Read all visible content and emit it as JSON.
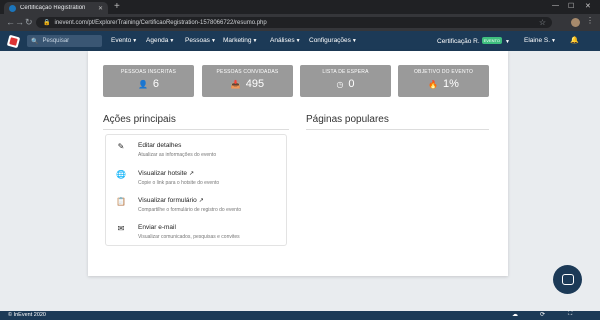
{
  "browser": {
    "tab_title": "Certificação Registration",
    "new_tab": "+",
    "url": "inevent.com/pt/ExplorerTraining/CertificaoRegistration-1578066722/resumo.php"
  },
  "appnav": {
    "search_placeholder": "Pesquisar",
    "menus": [
      "Evento",
      "Agenda",
      "Pessoas",
      "Marketing",
      "Análises",
      "Configurações"
    ],
    "event_name": "Certificação R.",
    "event_badge": "EVENTO",
    "user": "Elaine S."
  },
  "stats": [
    {
      "label": "PESSOAS INSCRITAS",
      "value": "6",
      "icon": "person-icon"
    },
    {
      "label": "PESSOAS CONVIDADAS",
      "value": "495",
      "icon": "inbox-icon"
    },
    {
      "label": "LISTA DE ESPERA",
      "value": "0",
      "icon": "clock-icon"
    },
    {
      "label": "OBJETIVO DO EVENTO",
      "value": "1%",
      "icon": "flame-icon"
    }
  ],
  "sections": {
    "actions_title": "Ações principais",
    "popular_title": "Páginas populares"
  },
  "actions": [
    {
      "title": "Editar detalhes",
      "desc": "Atualizar as informações do evento",
      "icon": "pencil-icon"
    },
    {
      "title": "Visualizar hotsite",
      "desc": "Copie o link para o hotsite do evento",
      "icon": "globe-icon"
    },
    {
      "title": "Visualizar formulário",
      "desc": "Compartilhe o formulário de registro do evento",
      "icon": "clipboard-icon"
    },
    {
      "title": "Enviar e-mail",
      "desc": "Visualizar comunicados, pesquisas e convites",
      "icon": "envelope-icon"
    }
  ],
  "footer": {
    "copyright": "© InEvent 2020"
  },
  "colors": {
    "nav": "#1c3a57",
    "stat_box": "#9a9a9a",
    "badge": "#3fbf7f"
  }
}
